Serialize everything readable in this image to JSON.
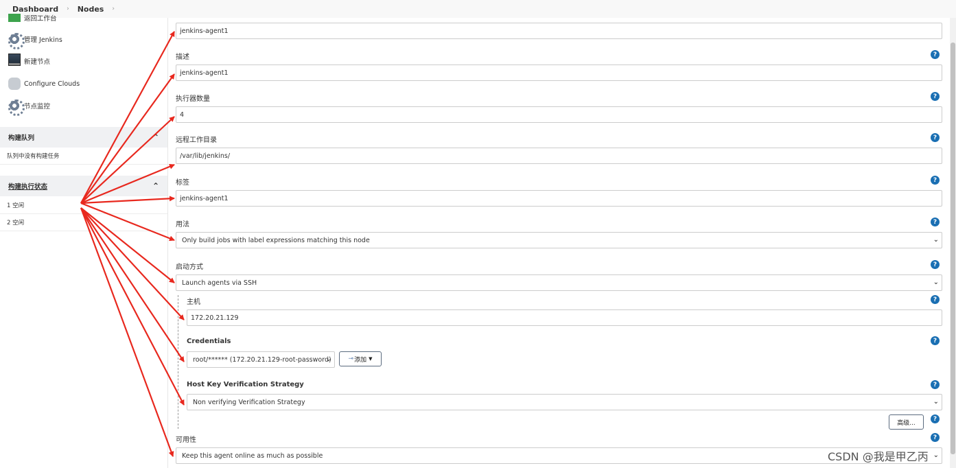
{
  "breadcrumb": {
    "items": [
      "Dashboard",
      "Nodes"
    ]
  },
  "sidebar": {
    "items": [
      {
        "label": "返回工作台",
        "icon": "green-square-icon"
      },
      {
        "label": "管理 Jenkins",
        "icon": "gear-icon"
      },
      {
        "label": "新建节点",
        "icon": "computer-icon"
      },
      {
        "label": "Configure Clouds",
        "icon": "cloud-icon"
      },
      {
        "label": "节点监控",
        "icon": "gear-icon"
      }
    ],
    "build_queue": {
      "title": "构建队列",
      "empty_text": "队列中没有构建任务"
    },
    "executor_status": {
      "title": "构建执行状态",
      "rows": [
        "1  空闲",
        "2  空闲"
      ]
    }
  },
  "form": {
    "name_value": "jenkins-agent1",
    "description": {
      "label": "描述",
      "value": "jenkins-agent1"
    },
    "executors": {
      "label": "执行器数量",
      "value": "4"
    },
    "remote_dir": {
      "label": "远程工作目录",
      "value": "/var/lib/jenkins/"
    },
    "labels": {
      "label": "标签",
      "value": "jenkins-agent1"
    },
    "usage": {
      "label": "用法",
      "value": "Only build jobs with label expressions matching this node"
    },
    "launch": {
      "label": "启动方式",
      "value": "Launch agents via SSH"
    },
    "host": {
      "label": "主机",
      "value": "172.20.21.129"
    },
    "credentials": {
      "label": "Credentials",
      "value": "root/****** (172.20.21.129-root-password)",
      "add_button": "添加"
    },
    "host_key": {
      "label": "Host Key Verification Strategy",
      "value": "Non verifying Verification Strategy"
    },
    "advanced_button": "高级...",
    "availability": {
      "label": "可用性",
      "value": "Keep this agent online as much as possible"
    }
  },
  "help_glyph": "?",
  "watermark": "CSDN @我是甲乙丙",
  "colors": {
    "arrow": "#e8281e",
    "help": "#1a6fb3"
  }
}
